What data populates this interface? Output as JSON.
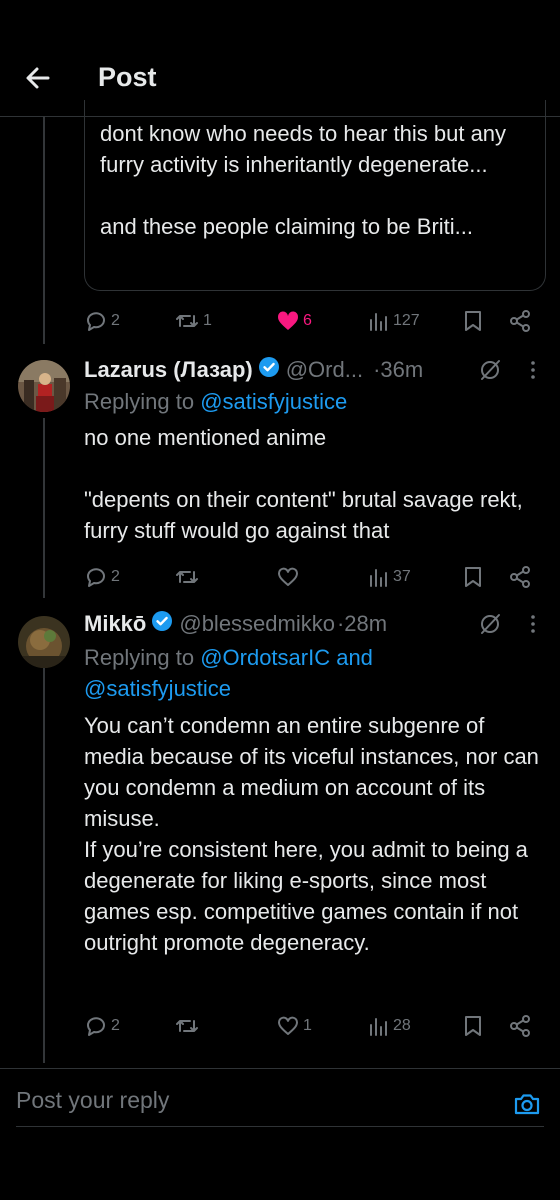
{
  "header": {
    "title": "Post",
    "back_icon": "arrow-left-icon"
  },
  "quoted_tweet": {
    "text": "dont know who needs to hear this but any furry activity is inheritantly degenerate...\n\nand these people claiming to be Briti...",
    "actions": {
      "replies": "2",
      "reposts": "1",
      "likes": "6",
      "views": "127",
      "liked": true
    }
  },
  "replies": [
    {
      "display_name": "Lazarus (Лазар)",
      "handle": "@Ord...",
      "time": "·36m",
      "verified": true,
      "replying_prefix": "Replying to ",
      "replying_to": "@satisfyjustice",
      "text": "no one mentioned anime\n\n\"depents on their content\" brutal savage rekt, furry stuff would go against that",
      "actions": {
        "replies": "2",
        "reposts": "",
        "likes": "",
        "views": "37"
      }
    },
    {
      "display_name": "Mikkō",
      "handle": "@blessedmikko",
      "time": "·28m",
      "verified": true,
      "replying_prefix": "Replying to ",
      "replying_to_line1": "@OrdotsarIC and",
      "replying_to_line2": "@satisfyjustice",
      "text": "You can’t condemn an entire subgenre of media because of its viceful instances, nor can you condemn a medium on account of its misuse.\nIf you’re consistent here, you admit to being a degenerate for liking e-sports, since most games esp. competitive games contain if not outright promote degeneracy.",
      "actions": {
        "replies": "2",
        "reposts": "",
        "likes": "1",
        "views": "28"
      }
    }
  ],
  "reply_bar": {
    "placeholder": "Post your reply",
    "camera_icon": "camera-icon"
  },
  "colors": {
    "background": "#000000",
    "text": "#e7e9ea",
    "secondary": "#71767b",
    "link": "#1d9bf0",
    "like": "#f91880",
    "divider": "#2f3336"
  }
}
